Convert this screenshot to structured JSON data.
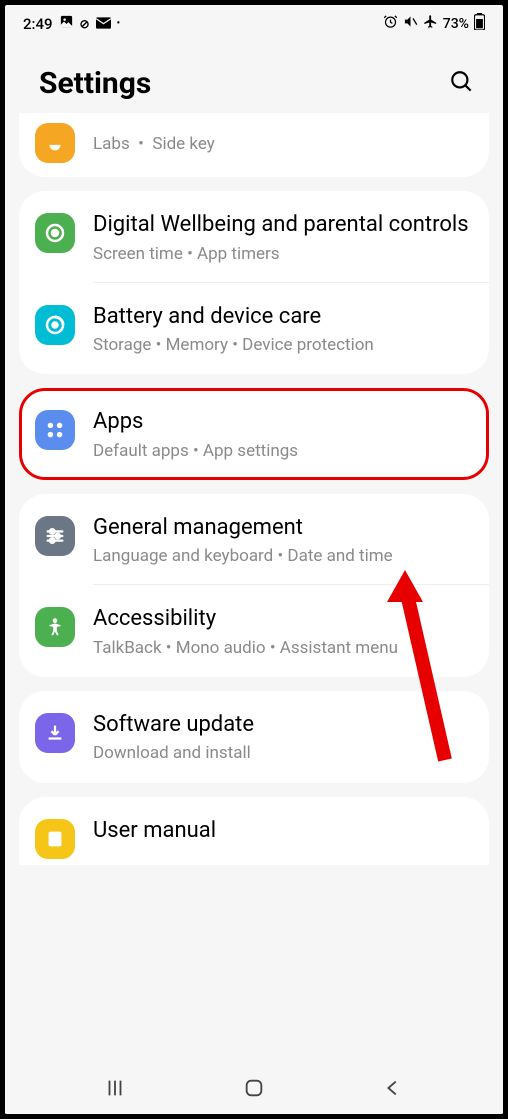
{
  "status": {
    "time": "2:49",
    "battery": "73%"
  },
  "header": {
    "title": "Settings"
  },
  "sections": {
    "labs": {
      "title": "Labs",
      "sub": "Side key"
    },
    "wellbeing": {
      "title": "Digital Wellbeing and parental controls",
      "sub": "Screen time  •  App timers"
    },
    "battery": {
      "title": "Battery and device care",
      "sub": "Storage  •  Memory  •  Device protection"
    },
    "apps": {
      "title": "Apps",
      "sub": "Default apps  •  App settings"
    },
    "general": {
      "title": "General management",
      "sub": "Language and keyboard  •  Date and time"
    },
    "accessibility": {
      "title": "Accessibility",
      "sub": "TalkBack  •  Mono audio  •  Assistant menu"
    },
    "software": {
      "title": "Software update",
      "sub": "Download and install"
    },
    "manual": {
      "title": "User manual"
    }
  }
}
